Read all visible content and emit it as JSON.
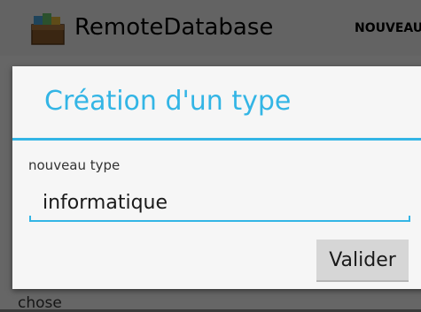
{
  "action_bar": {
    "app_title": "RemoteDatabase",
    "action_label": "NOUVEAU"
  },
  "background": {
    "list_text": "chose"
  },
  "dialog": {
    "title": "Création d'un type",
    "field_label": "nouveau type",
    "field_value": "informatique",
    "submit_label": "Valider"
  },
  "colors": {
    "accent": "#33b5e5",
    "dialog_bg": "#f6f6f6",
    "button_bg": "#d6d6d6"
  },
  "icons": {
    "app_icon": "treasure-box-icon"
  }
}
